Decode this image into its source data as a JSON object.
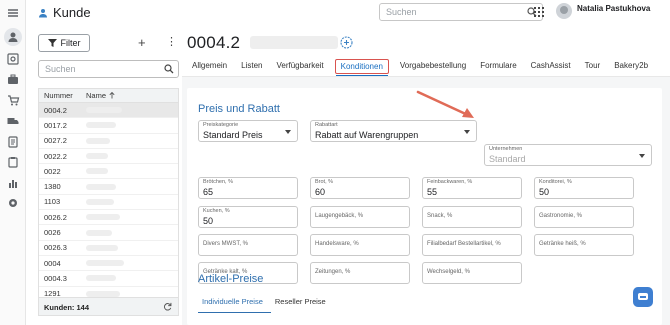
{
  "app": {
    "title": "Kunde"
  },
  "topbar": {
    "search_placeholder": "Suchen",
    "user_name": "Natalia Pastukhova"
  },
  "list": {
    "filter_label": "Filter",
    "search_placeholder": "Suchen",
    "col_number": "Nummer",
    "col_name": "Name",
    "rows": [
      "0004.2",
      "0017.2",
      "0027.2",
      "0022.2",
      "0022",
      "1380",
      "1103",
      "0026.2",
      "0026",
      "0026.3",
      "0004",
      "0004.3",
      "1291"
    ],
    "footer_count": "Kunden: 144"
  },
  "record": {
    "id": "0004.2"
  },
  "tabs": [
    "Allgemein",
    "Listen",
    "Verfügbarkeit",
    "Konditionen",
    "Vorgabebestellung",
    "Formulare",
    "CashAssist",
    "Tour",
    "Bakery2b"
  ],
  "active_tab_index": 3,
  "sections": {
    "pricing_title": "Preis und Rabatt",
    "article_prices_title": "Artikel-Preise"
  },
  "fields": {
    "preiskategorie": {
      "label": "Preiskategorie",
      "value": "Standard Preis"
    },
    "rabattart": {
      "label": "Rabattart",
      "value": "Rabatt auf Warengruppen"
    },
    "unternehmen": {
      "label": "Unternehmen",
      "value": "Standard"
    },
    "discounts": [
      {
        "label": "Brötchen, %",
        "value": "65"
      },
      {
        "label": "Brot, %",
        "value": "60"
      },
      {
        "label": "Feinbackwaren, %",
        "value": "55"
      },
      {
        "label": "Konditorei, %",
        "value": "50"
      },
      {
        "label": "Kuchen, %",
        "value": "50"
      },
      {
        "label": "Laugengebäck, %",
        "value": ""
      },
      {
        "label": "Snack, %",
        "value": ""
      },
      {
        "label": "Gastronomie, %",
        "value": ""
      },
      {
        "label": "Divers MWST, %",
        "value": ""
      },
      {
        "label": "Handelsware, %",
        "value": ""
      },
      {
        "label": "Filialbedarf Bestellartikel, %",
        "value": ""
      },
      {
        "label": "Getränke heiß, %",
        "value": ""
      },
      {
        "label": "Getränke kalt, %",
        "value": ""
      },
      {
        "label": "Zeitungen, %",
        "value": ""
      },
      {
        "label": "Wechselgeld, %",
        "value": ""
      }
    ]
  },
  "subtabs": [
    "Individuelle Preise",
    "Reseller Preise"
  ],
  "colors": {
    "accent": "#2f6fae",
    "highlight": "#d9534f",
    "arrow": "#e06b57"
  }
}
